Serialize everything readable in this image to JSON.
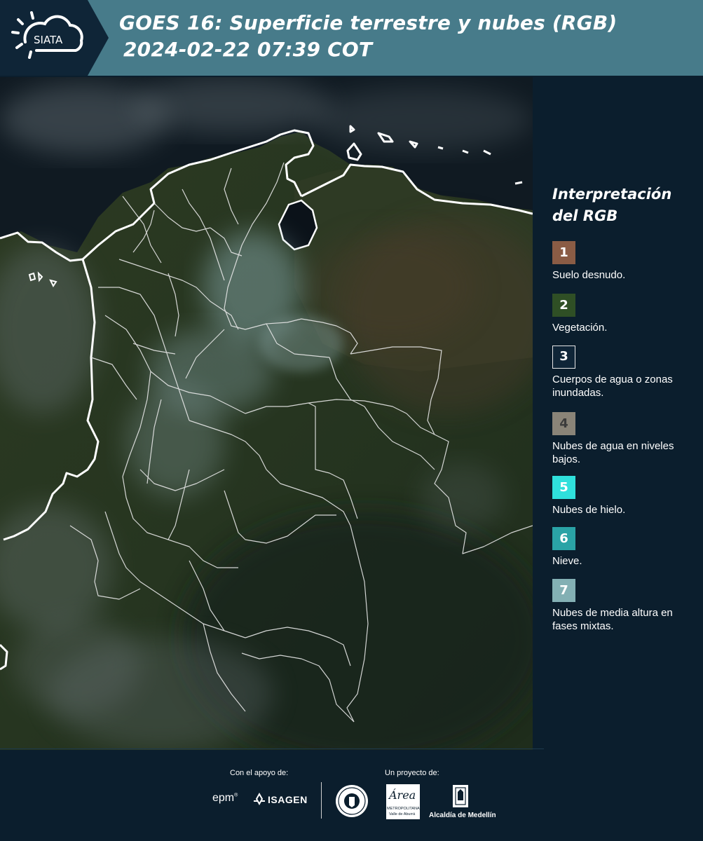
{
  "header": {
    "logo_text": "SIATA",
    "title_line1": "GOES 16: Superficie terrestre y nubes (RGB)",
    "title_line2": "2024-02-22 07:39 COT"
  },
  "legend": {
    "title_line1": "Interpretación",
    "title_line2": "del RGB",
    "items": [
      {
        "number": "1",
        "color": "#8a5c45",
        "label": "Suelo desnudo."
      },
      {
        "number": "2",
        "color": "#2f4f25",
        "label": "Vegetación."
      },
      {
        "number": "3",
        "color": "#0f2537",
        "label": "Cuerpos de agua o zonas inundadas."
      },
      {
        "number": "4",
        "color": "#8a8478",
        "label": "Nubes de agua en niveles bajos."
      },
      {
        "number": "5",
        "color": "#2fe0dc",
        "label": "Nubes de hielo."
      },
      {
        "number": "6",
        "color": "#2aa3a6",
        "label": "Nieve."
      },
      {
        "number": "7",
        "color": "#83b0b4",
        "label": "Nubes de media altura en fases mixtas."
      }
    ]
  },
  "footer": {
    "support_label": "Con el apoyo de:",
    "project_label": "Un proyecto de:",
    "epm_text": "epm",
    "isagen_text": "ISAGEN",
    "area_text": "Área",
    "area_sub1": "METROPOLITANA",
    "area_sub2": "Valle de Aburrá",
    "alcaldia_text": "Alcaldía de Medellín"
  }
}
